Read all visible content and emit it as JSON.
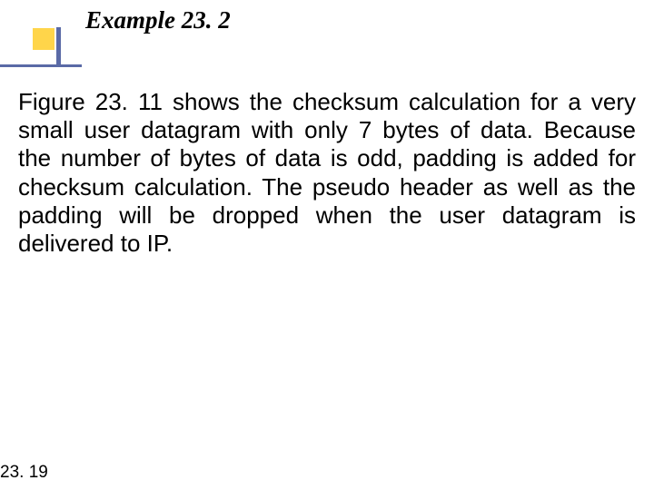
{
  "title": "Example 23. 2",
  "body": "Figure 23. 11 shows the checksum calculation for a very small user datagram with only 7 bytes of data. Because the number of bytes of data is odd, padding is added for checksum calculation. The pseudo header as well as the padding will be dropped when the user datagram is delivered to IP.",
  "page": "23. 19"
}
